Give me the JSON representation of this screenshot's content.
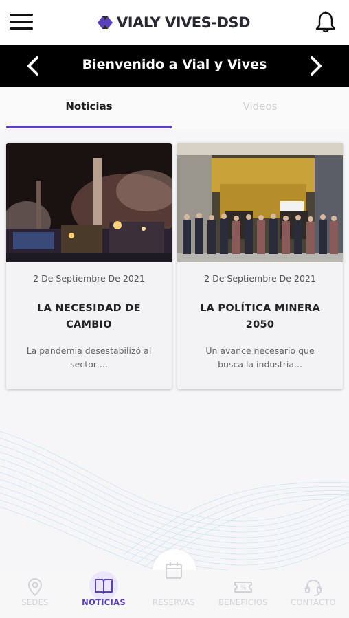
{
  "header": {
    "brand": "VIALY VIVES-DSD",
    "menu_icon": "hamburger-menu-icon",
    "bell_icon": "bell-icon"
  },
  "banner": {
    "title": "Bienvenido a Vial y Vives",
    "prev_icon": "chevron-left-icon",
    "next_icon": "chevron-right-icon"
  },
  "tabs": [
    {
      "label": "Noticias",
      "active": true
    },
    {
      "label": "Videos",
      "active": false
    }
  ],
  "news": [
    {
      "date": "2 De Septiembre De 2021",
      "title": "LA NECESIDAD DE CAMBIO",
      "excerpt": "La pandemia desestabilizó al sector ...",
      "image": "industrial-plant-night-image"
    },
    {
      "date": "2 De Septiembre De 2021",
      "title": "LA POLÍTICA MINERA 2050",
      "excerpt": "Un avance necesario que busca la industria...",
      "image": "mining-truck-group-photo-image"
    }
  ],
  "bottom_nav": [
    {
      "label": "SEDES",
      "icon": "location-pin-icon",
      "active": false
    },
    {
      "label": "NOTICIAS",
      "icon": "book-icon",
      "active": true
    },
    {
      "label": "RESERVAS",
      "icon": "calendar-icon",
      "active": false
    },
    {
      "label": "BENEFICIOS",
      "icon": "ticket-icon",
      "active": false
    },
    {
      "label": "CONTACTO",
      "icon": "headset-icon",
      "active": false
    }
  ],
  "colors": {
    "accent": "#5a3fbf",
    "banner_bg": "#000000",
    "inactive": "#d2d2d8"
  }
}
